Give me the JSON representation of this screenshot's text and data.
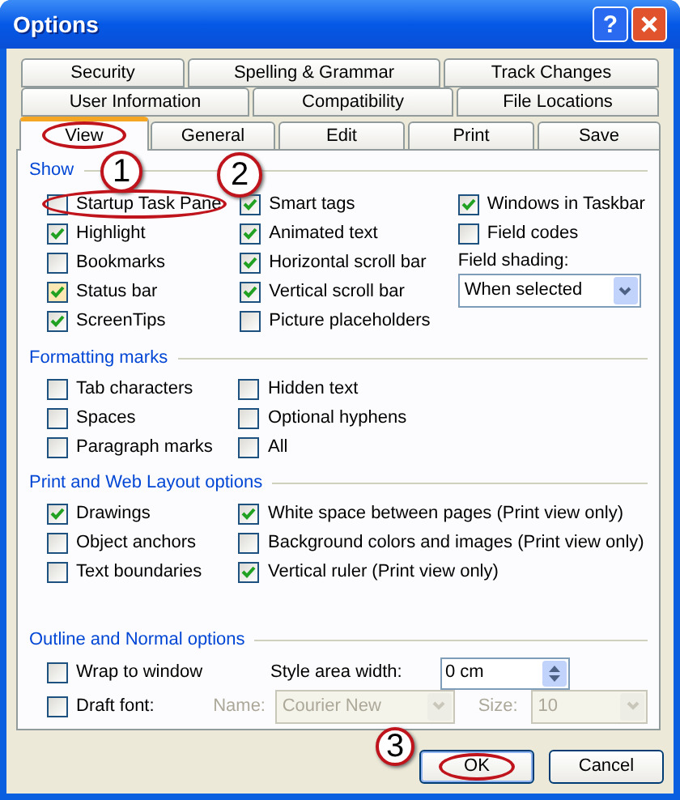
{
  "window": {
    "title": "Options"
  },
  "title_buttons": [
    {
      "kind": "help",
      "label": "?"
    },
    {
      "kind": "close"
    }
  ],
  "tab_rows": [
    [
      {
        "label": "Security",
        "selected": false
      },
      {
        "label": "Spelling & Grammar",
        "selected": false
      },
      {
        "label": "Track Changes",
        "selected": false
      }
    ],
    [
      {
        "label": "User Information",
        "selected": false
      },
      {
        "label": "Compatibility",
        "selected": false
      },
      {
        "label": "File Locations",
        "selected": false
      }
    ],
    [
      {
        "label": "View",
        "selected": true,
        "circled": true
      },
      {
        "label": "General",
        "selected": false
      },
      {
        "label": "Edit",
        "selected": false
      },
      {
        "label": "Print",
        "selected": false
      },
      {
        "label": "Save",
        "selected": false
      }
    ]
  ],
  "sections": [
    {
      "title": "Show",
      "columns": [
        [
          {
            "kind": "checkbox",
            "label": "Startup Task Pane",
            "checked": false,
            "circled": true
          },
          {
            "kind": "checkbox",
            "label": "Highlight",
            "checked": true
          },
          {
            "kind": "checkbox",
            "label": "Bookmarks",
            "checked": false
          },
          {
            "kind": "checkbox",
            "label": "Status bar",
            "checked": true,
            "hover": true
          },
          {
            "kind": "checkbox",
            "label": "ScreenTips",
            "checked": true
          }
        ],
        [
          {
            "kind": "checkbox",
            "label": "Smart tags",
            "checked": true
          },
          {
            "kind": "checkbox",
            "label": "Animated text",
            "checked": true
          },
          {
            "kind": "checkbox",
            "label": "Horizontal scroll bar",
            "checked": true
          },
          {
            "kind": "checkbox",
            "label": "Vertical scroll bar",
            "checked": true
          },
          {
            "kind": "checkbox",
            "label": "Picture placeholders",
            "checked": false
          }
        ],
        [
          {
            "kind": "checkbox",
            "label": "Windows in Taskbar",
            "checked": true
          },
          {
            "kind": "checkbox",
            "label": "Field codes",
            "checked": false
          },
          {
            "kind": "label",
            "label": "Field shading:"
          },
          {
            "kind": "dropdown",
            "value": "When selected"
          }
        ]
      ]
    },
    {
      "title": "Formatting marks",
      "columns": [
        [
          {
            "kind": "checkbox",
            "label": "Tab characters",
            "checked": false
          },
          {
            "kind": "checkbox",
            "label": "Spaces",
            "checked": false
          },
          {
            "kind": "checkbox",
            "label": "Paragraph marks",
            "checked": false
          }
        ],
        [
          {
            "kind": "checkbox",
            "label": "Hidden text",
            "checked": false
          },
          {
            "kind": "checkbox",
            "label": "Optional hyphens",
            "checked": false
          },
          {
            "kind": "checkbox",
            "label": "All",
            "checked": false
          }
        ]
      ]
    },
    {
      "title": "Print and Web Layout options",
      "columns": [
        [
          {
            "kind": "checkbox",
            "label": "Drawings",
            "checked": true
          },
          {
            "kind": "checkbox",
            "label": "Object anchors",
            "checked": false
          },
          {
            "kind": "checkbox",
            "label": "Text boundaries",
            "checked": false
          }
        ],
        [
          {
            "kind": "checkbox",
            "label": "White space between pages (Print view only)",
            "checked": true
          },
          {
            "kind": "checkbox",
            "label": "Background colors and images (Print view only)",
            "checked": false
          },
          {
            "kind": "checkbox",
            "label": "Vertical ruler (Print view only)",
            "checked": true
          }
        ]
      ]
    }
  ],
  "outline": {
    "title": "Outline and Normal options",
    "wrap": {
      "label": "Wrap to window",
      "checked": false
    },
    "style_area": {
      "label": "Style area width:",
      "value": "0 cm"
    },
    "draft": {
      "label": "Draft font:",
      "checked": false
    },
    "name": {
      "label": "Name:",
      "value": "Courier New",
      "disabled": true
    },
    "size": {
      "label": "Size:",
      "value": "10",
      "disabled": true
    }
  },
  "buttons": [
    {
      "label": "OK",
      "default": true,
      "circled": true
    },
    {
      "label": "Cancel",
      "default": false
    }
  ],
  "callouts": [
    {
      "number": "1"
    },
    {
      "number": "2"
    },
    {
      "number": "3"
    }
  ]
}
